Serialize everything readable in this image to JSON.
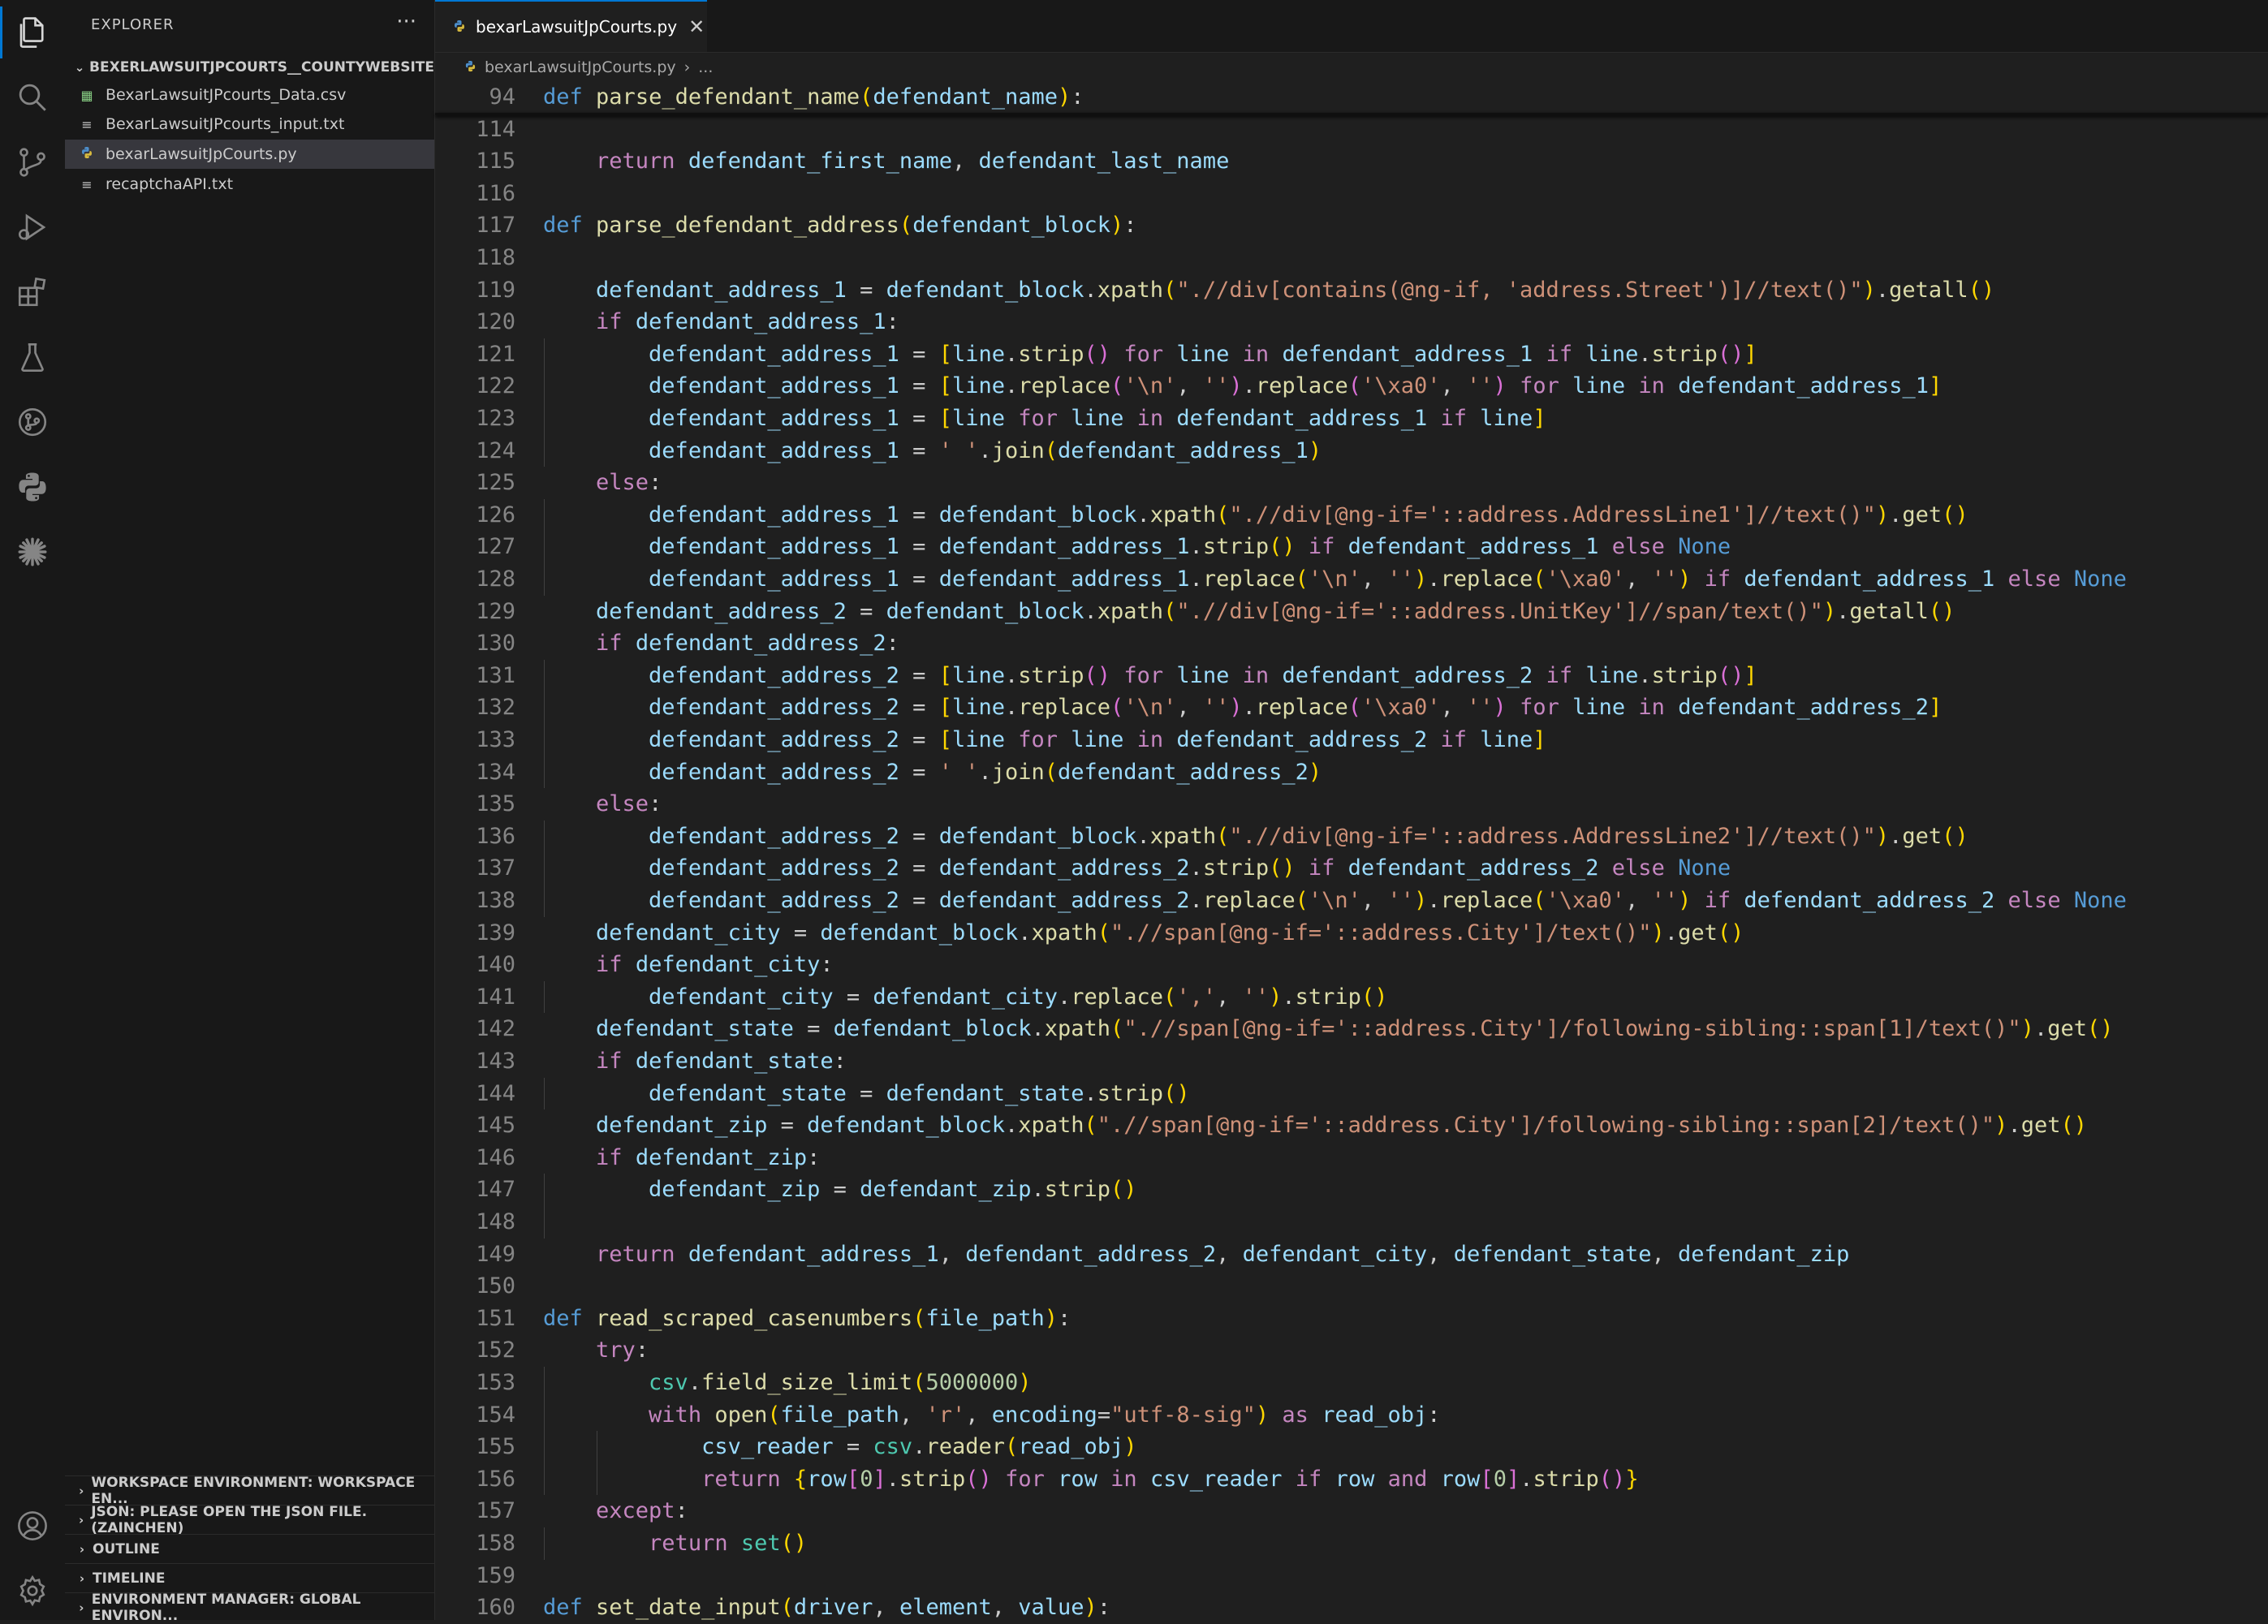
{
  "sidebar": {
    "title": "EXPLORER",
    "more": "···",
    "folder": "BEXERLAWSUITJPCOURTS__COUNTYWEBSITE",
    "files": [
      {
        "name": "BexarLawsuitJPcourts_Data.csv",
        "icon": "csv-icon"
      },
      {
        "name": "BexarLawsuitJPcourts_input.txt",
        "icon": "text-file-icon"
      },
      {
        "name": "bexarLawsuitJpCourts.py",
        "icon": "python-icon"
      },
      {
        "name": "recaptchaAPI.txt",
        "icon": "text-file-icon"
      }
    ],
    "sections": [
      "WORKSPACE ENVIRONMENT: WORKSPACE EN...",
      "JSON: PLEASE OPEN THE JSON FILE.(ZAINCHEN)",
      "OUTLINE",
      "TIMELINE",
      "ENVIRONMENT MANAGER: GLOBAL ENVIRON..."
    ]
  },
  "tab": {
    "label": "bexarLawsuitJpCourts.py",
    "close": "✕"
  },
  "breadcrumb": {
    "file": "bexarLawsuitJpCourts.py",
    "more": "..."
  },
  "colors": {
    "accent": "#0078d4",
    "editor_bg": "#1f1f1f",
    "sidebar_bg": "#181818"
  },
  "code": {
    "sticky": {
      "n": "94",
      "text": "def parse_defendant_name(defendant_name):"
    },
    "lines": [
      {
        "n": "114",
        "text": ""
      },
      {
        "n": "115",
        "text": "    return defendant_first_name, defendant_last_name"
      },
      {
        "n": "116",
        "text": ""
      },
      {
        "n": "117",
        "text": "def parse_defendant_address(defendant_block):"
      },
      {
        "n": "118",
        "text": ""
      },
      {
        "n": "119",
        "text": "    defendant_address_1 = defendant_block.xpath(\".//div[contains(@ng-if, 'address.Street')]//text()\").getall()"
      },
      {
        "n": "120",
        "text": "    if defendant_address_1:"
      },
      {
        "n": "121",
        "text": "        defendant_address_1 = [line.strip() for line in defendant_address_1 if line.strip()]"
      },
      {
        "n": "122",
        "text": "        defendant_address_1 = [line.replace('\\n', '').replace('\\xa0', '') for line in defendant_address_1]"
      },
      {
        "n": "123",
        "text": "        defendant_address_1 = [line for line in defendant_address_1 if line]"
      },
      {
        "n": "124",
        "text": "        defendant_address_1 = ' '.join(defendant_address_1)"
      },
      {
        "n": "125",
        "text": "    else:"
      },
      {
        "n": "126",
        "text": "        defendant_address_1 = defendant_block.xpath(\".//div[@ng-if='::address.AddressLine1']//text()\").get()"
      },
      {
        "n": "127",
        "text": "        defendant_address_1 = defendant_address_1.strip() if defendant_address_1 else None"
      },
      {
        "n": "128",
        "text": "        defendant_address_1 = defendant_address_1.replace('\\n', '').replace('\\xa0', '') if defendant_address_1 else None"
      },
      {
        "n": "129",
        "text": "    defendant_address_2 = defendant_block.xpath(\".//div[@ng-if='::address.UnitKey']//span/text()\").getall()"
      },
      {
        "n": "130",
        "text": "    if defendant_address_2:"
      },
      {
        "n": "131",
        "text": "        defendant_address_2 = [line.strip() for line in defendant_address_2 if line.strip()]"
      },
      {
        "n": "132",
        "text": "        defendant_address_2 = [line.replace('\\n', '').replace('\\xa0', '') for line in defendant_address_2]"
      },
      {
        "n": "133",
        "text": "        defendant_address_2 = [line for line in defendant_address_2 if line]"
      },
      {
        "n": "134",
        "text": "        defendant_address_2 = ' '.join(defendant_address_2)"
      },
      {
        "n": "135",
        "text": "    else:"
      },
      {
        "n": "136",
        "text": "        defendant_address_2 = defendant_block.xpath(\".//div[@ng-if='::address.AddressLine2']//text()\").get()"
      },
      {
        "n": "137",
        "text": "        defendant_address_2 = defendant_address_2.strip() if defendant_address_2 else None"
      },
      {
        "n": "138",
        "text": "        defendant_address_2 = defendant_address_2.replace('\\n', '').replace('\\xa0', '') if defendant_address_2 else None"
      },
      {
        "n": "139",
        "text": "    defendant_city = defendant_block.xpath(\".//span[@ng-if='::address.City']/text()\").get()"
      },
      {
        "n": "140",
        "text": "    if defendant_city:"
      },
      {
        "n": "141",
        "text": "        defendant_city = defendant_city.replace(',', '').strip()"
      },
      {
        "n": "142",
        "text": "    defendant_state = defendant_block.xpath(\".//span[@ng-if='::address.City']/following-sibling::span[1]/text()\").get()"
      },
      {
        "n": "143",
        "text": "    if defendant_state:"
      },
      {
        "n": "144",
        "text": "        defendant_state = defendant_state.strip()"
      },
      {
        "n": "145",
        "text": "    defendant_zip = defendant_block.xpath(\".//span[@ng-if='::address.City']/following-sibling::span[2]/text()\").get()"
      },
      {
        "n": "146",
        "text": "    if defendant_zip:"
      },
      {
        "n": "147",
        "text": "        defendant_zip = defendant_zip.strip()"
      },
      {
        "n": "148",
        "text": ""
      },
      {
        "n": "149",
        "text": "    return defendant_address_1, defendant_address_2, defendant_city, defendant_state, defendant_zip"
      },
      {
        "n": "150",
        "text": ""
      },
      {
        "n": "151",
        "text": "def read_scraped_casenumbers(file_path):"
      },
      {
        "n": "152",
        "text": "    try:"
      },
      {
        "n": "153",
        "text": "        csv.field_size_limit(5000000)"
      },
      {
        "n": "154",
        "text": "        with open(file_path, 'r', encoding=\"utf-8-sig\") as read_obj:"
      },
      {
        "n": "155",
        "text": "            csv_reader = csv.reader(read_obj)"
      },
      {
        "n": "156",
        "text": "            return {row[0].strip() for row in csv_reader if row and row[0].strip()}"
      },
      {
        "n": "157",
        "text": "    except:"
      },
      {
        "n": "158",
        "text": "        return set()"
      },
      {
        "n": "159",
        "text": ""
      },
      {
        "n": "160",
        "text": "def set_date_input(driver, element, value):"
      }
    ]
  }
}
